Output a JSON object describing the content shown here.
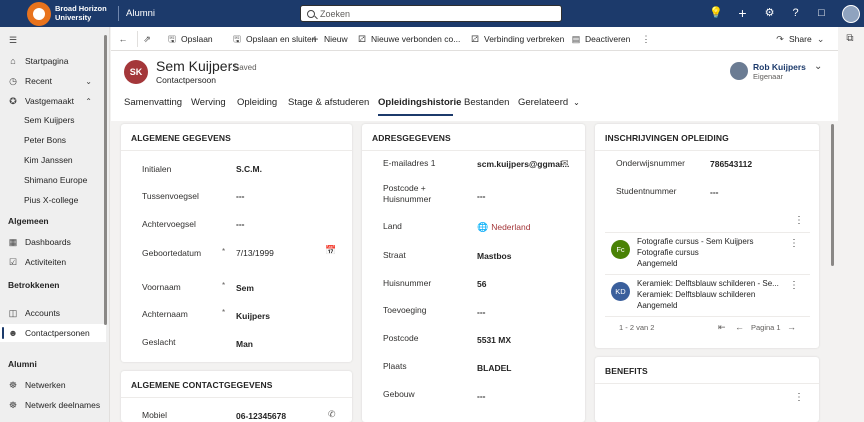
{
  "topbar": {
    "brand_line1": "Broad Horizon",
    "brand_line2": "University",
    "app_name": "Alumni",
    "search_placeholder": "Zoeken"
  },
  "sidebar": {
    "items": [
      {
        "label": "Startpagina"
      },
      {
        "label": "Recent"
      },
      {
        "label": "Vastgemaakt"
      },
      {
        "label": "Sem Kuijpers"
      },
      {
        "label": "Peter Bons"
      },
      {
        "label": "Kim Janssen"
      },
      {
        "label": "Shimano Europe"
      },
      {
        "label": "Pius X-college"
      }
    ],
    "section_algemeen": "Algemeen",
    "algemeen_items": [
      {
        "label": "Dashboards"
      },
      {
        "label": "Activiteiten"
      }
    ],
    "section_betrokkenen": "Betrokkenen",
    "betrokkenen_items": [
      {
        "label": "Accounts"
      },
      {
        "label": "Contactpersonen"
      }
    ],
    "section_alumni": "Alumni",
    "alumni_items": [
      {
        "label": "Netwerken"
      },
      {
        "label": "Netwerk deelnames"
      }
    ]
  },
  "commands": {
    "save": "Opslaan",
    "save_close": "Opslaan en sluiten",
    "new": "Nieuw",
    "new_connection": "Nieuwe verbonden co...",
    "break_connection": "Verbinding verbreken",
    "deactivate": "Deactiveren",
    "share": "Share"
  },
  "record": {
    "initials": "SK",
    "title": "Sem Kuijpers",
    "saved": "- Saved",
    "type": "Contactpersoon",
    "owner_name": "Rob Kuijpers",
    "owner_role": "Eigenaar"
  },
  "tabs": [
    "Samenvatting",
    "Werving",
    "Opleiding",
    "Stage & afstuderen",
    "Opleidingshistorie",
    "Bestanden",
    "Gerelateerd"
  ],
  "general": {
    "title": "ALGEMENE GEGEVENS",
    "fields": [
      {
        "label": "Initialen",
        "value": "S.C.M."
      },
      {
        "label": "Tussenvoegsel",
        "value": "---"
      },
      {
        "label": "Achtervoegsel",
        "value": "---"
      },
      {
        "label": "Geboortedatum",
        "value": "7/13/1999"
      },
      {
        "label": "Voornaam",
        "value": "Sem"
      },
      {
        "label": "Achternaam",
        "value": "Kuijpers"
      },
      {
        "label": "Geslacht",
        "value": "Man"
      }
    ]
  },
  "contact": {
    "title": "ALGEMENE CONTACTGEGEVENS",
    "fields": [
      {
        "label": "Mobiel",
        "value": "06-12345678"
      }
    ]
  },
  "address": {
    "title": "ADRESGEGEVENS",
    "fields": [
      {
        "label": "E-mailadres 1",
        "value": "scm.kuijpers@ggmai..."
      },
      {
        "label": "Postcode + Huisnummer",
        "value": "---"
      },
      {
        "label": "Land",
        "value": "Nederland"
      },
      {
        "label": "Straat",
        "value": "Mastbos"
      },
      {
        "label": "Huisnummer",
        "value": "56"
      },
      {
        "label": "Toevoeging",
        "value": "---"
      },
      {
        "label": "Postcode",
        "value": "5531 MX"
      },
      {
        "label": "Plaats",
        "value": "BLADEL"
      },
      {
        "label": "Gebouw",
        "value": "---"
      }
    ]
  },
  "enrollments": {
    "title": "INSCHRIJVINGEN OPLEIDING",
    "fields": [
      {
        "label": "Onderwijsnummer",
        "value": "786543112"
      },
      {
        "label": "Studentnummer",
        "value": "---"
      }
    ],
    "items": [
      {
        "initials": "Fc",
        "color": "#498205",
        "line1": "Fotografie cursus - Sem Kuijpers",
        "line2": "Fotografie cursus",
        "line3": "Aangemeld"
      },
      {
        "initials": "KD",
        "color": "#3a5f9c",
        "line1": "Keramiek: Delftsblauw schilderen - Se...",
        "line2": "Keramiek: Delftsblauw schilderen",
        "line3": "Aangemeld"
      }
    ],
    "pager_range": "1 - 2 van 2",
    "pager_page": "Pagina 1"
  },
  "benefits": {
    "title": "BENEFITS"
  }
}
